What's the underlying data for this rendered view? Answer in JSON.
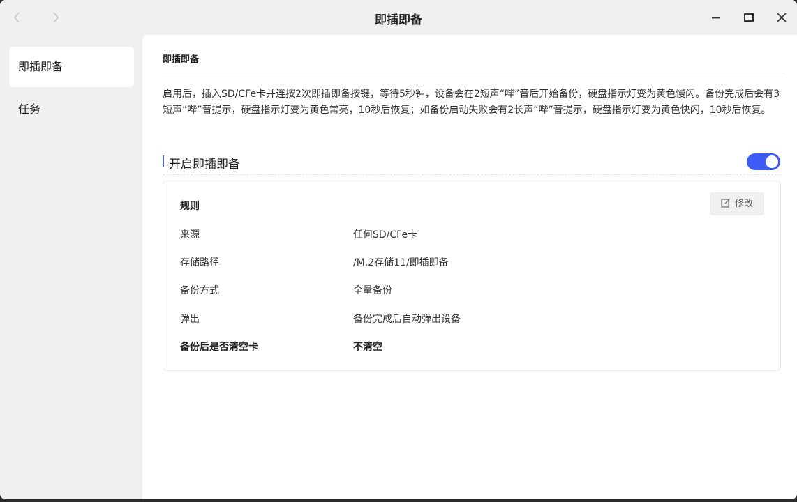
{
  "window": {
    "title": "即插即备",
    "nav_back_icon": "chevron-left-icon",
    "nav_forward_icon": "chevron-right-icon",
    "minimize_icon": "minimize-icon",
    "maximize_icon": "maximize-icon",
    "close_icon": "close-icon"
  },
  "sidebar": {
    "items": [
      {
        "label": "即插即备",
        "active": true
      },
      {
        "label": "任务",
        "active": false
      }
    ]
  },
  "main": {
    "section_title": "即插即备",
    "description": "启用后，插入SD/CFe卡并连按2次即插即备按键，等待5秒钟，设备会在2短声“哔”音后开始备份，硬盘指示灯变为黄色慢闪。备份完成后会有3短声“哔”音提示，硬盘指示灯变为黄色常亮，10秒后恢复；如备份启动失败会有2长声“哔”音提示，硬盘指示灯变为黄色快闪，10秒后恢复。",
    "toggle": {
      "label": "开启即插即备",
      "on": true,
      "accent": "#3d5cf5"
    },
    "rules": {
      "title": "规则",
      "edit_label": "修改",
      "rows": [
        {
          "label": "来源",
          "value": "任何SD/CFe卡"
        },
        {
          "label": "存储路径",
          "value": "/M.2存储11/即插即备"
        },
        {
          "label": "备份方式",
          "value": "全量备份"
        },
        {
          "label": "弹出",
          "value": "备份完成后自动弹出设备"
        },
        {
          "label": "备份后是否清空卡",
          "value": "不清空"
        }
      ]
    }
  }
}
